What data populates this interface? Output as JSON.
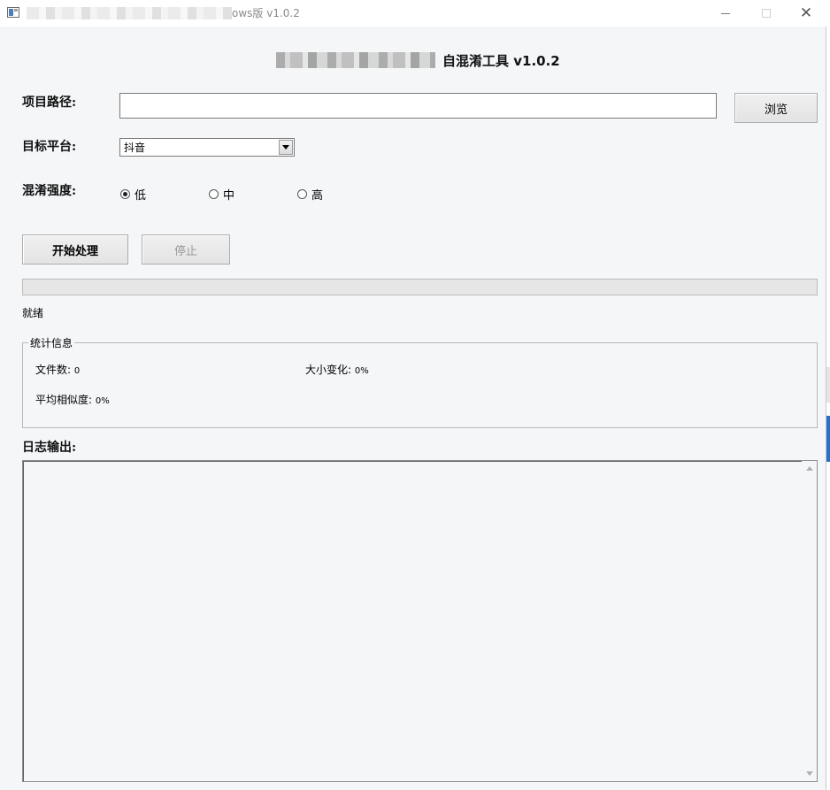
{
  "window": {
    "title": "ows版 v1.0.2",
    "controls": {
      "minimize": "minimize",
      "maximize": "maximize",
      "close": "✕"
    }
  },
  "header": {
    "title": "自混淆工具 v1.0.2"
  },
  "form": {
    "path_label": "项目路径:",
    "path_value": "",
    "browse_label": "浏览",
    "platform_label": "目标平台:",
    "platform_selected": "抖音",
    "strength_label": "混淆强度:",
    "strength_options": [
      {
        "label": "低",
        "checked": true
      },
      {
        "label": "中",
        "checked": false
      },
      {
        "label": "高",
        "checked": false
      }
    ]
  },
  "actions": {
    "start_label": "开始处理",
    "stop_label": "停止",
    "stop_enabled": false
  },
  "progress": {
    "value": 0
  },
  "status": {
    "text": "就绪"
  },
  "stats": {
    "title": "统计信息",
    "file_count_label": "文件数:",
    "file_count_value": "0",
    "size_change_label": "大小变化:",
    "size_change_value": "0%",
    "avg_similarity_label": "平均相似度:",
    "avg_similarity_value": "0%"
  },
  "log": {
    "label": "日志输出:",
    "content": ""
  },
  "colors": {
    "accent": "#2a6fc9",
    "window_bg": "#f4f6f8",
    "progress_fill": "#06b025"
  },
  "icons": {
    "app": "app-window-icon",
    "scroll_up": "scroll-up-icon",
    "scroll_down": "scroll-down-icon",
    "dropdown": "chevron-down-icon"
  }
}
